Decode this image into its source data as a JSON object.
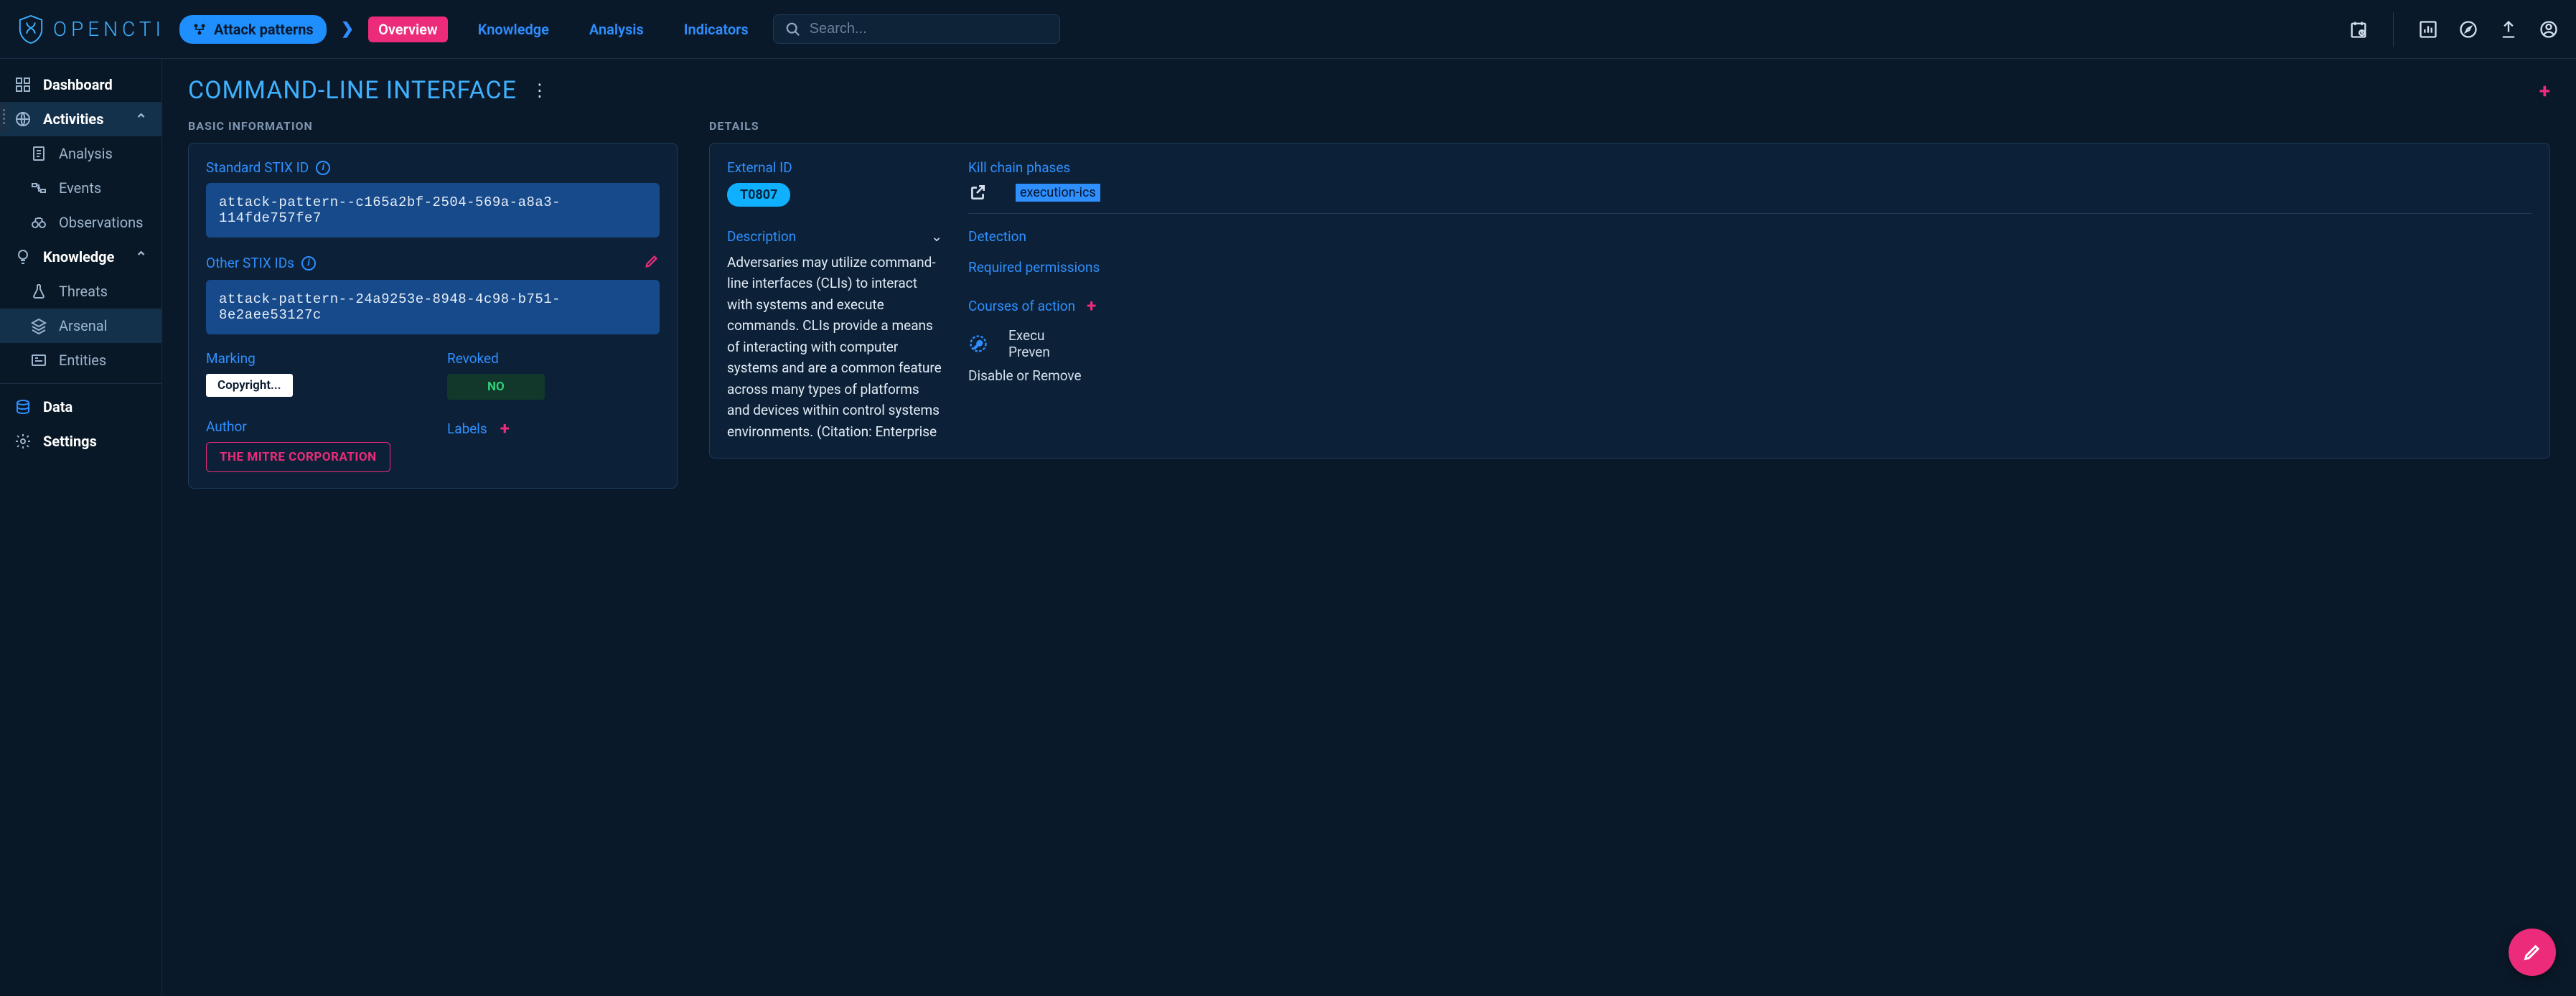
{
  "brand": "OPENCTI",
  "breadcrumb": {
    "chip_label": "Attack patterns"
  },
  "tabs": [
    {
      "label": "Overview",
      "active": true
    },
    {
      "label": "Knowledge",
      "active": false
    },
    {
      "label": "Analysis",
      "active": false
    },
    {
      "label": "Indicators",
      "active": false
    }
  ],
  "search": {
    "placeholder": "Search..."
  },
  "sidebar": {
    "items": [
      {
        "label": "Dashboard",
        "kind": "item",
        "level": 0
      },
      {
        "label": "Activities",
        "kind": "group",
        "active": true,
        "expanded": true
      },
      {
        "label": "Analysis",
        "kind": "item",
        "level": 1
      },
      {
        "label": "Events",
        "kind": "item",
        "level": 1
      },
      {
        "label": "Observations",
        "kind": "item",
        "level": 1
      },
      {
        "label": "Knowledge",
        "kind": "group",
        "expanded": true
      },
      {
        "label": "Threats",
        "kind": "item",
        "level": 1
      },
      {
        "label": "Arsenal",
        "kind": "item",
        "level": 1,
        "active": true
      },
      {
        "label": "Entities",
        "kind": "item",
        "level": 1
      },
      {
        "label": "Data",
        "kind": "item",
        "level": 0,
        "sepBefore": true
      },
      {
        "label": "Settings",
        "kind": "item",
        "level": 0
      }
    ]
  },
  "page": {
    "title": "COMMAND-LINE INTERFACE",
    "basic_info_label": "BASIC INFORMATION",
    "details_label": "DETAILS"
  },
  "basic": {
    "stix_id_label": "Standard STIX ID",
    "stix_id_value": "attack-pattern--c165a2bf-2504-569a-a8a3-114fde757fe7",
    "other_stix_label": "Other STIX IDs",
    "other_stix_value": "attack-pattern--24a9253e-8948-4c98-b751-8e2aee53127c",
    "marking_label": "Marking",
    "marking_value": "Copyright...",
    "revoked_label": "Revoked",
    "revoked_value": "NO",
    "author_label": "Author",
    "author_value": "THE MITRE CORPORATION",
    "labels_label": "Labels"
  },
  "details": {
    "external_id_label": "External ID",
    "external_id_value": "T0807",
    "description_label": "Description",
    "description_value": "Adversaries may utilize command-line interfaces (CLIs) to interact with systems and execute commands. CLIs provide a means of interacting with computer systems and are a common feature across many types of platforms and devices within control systems environments. (Citation: Enterprise",
    "kill_chain_label": "Kill chain phases",
    "kill_chain_value": "execution-ics",
    "detection_label": "Detection",
    "permissions_label": "Required permissions",
    "coa_label": "Courses of action",
    "coa_items": [
      "Execu\nPreven",
      "Disable or Remove"
    ]
  }
}
